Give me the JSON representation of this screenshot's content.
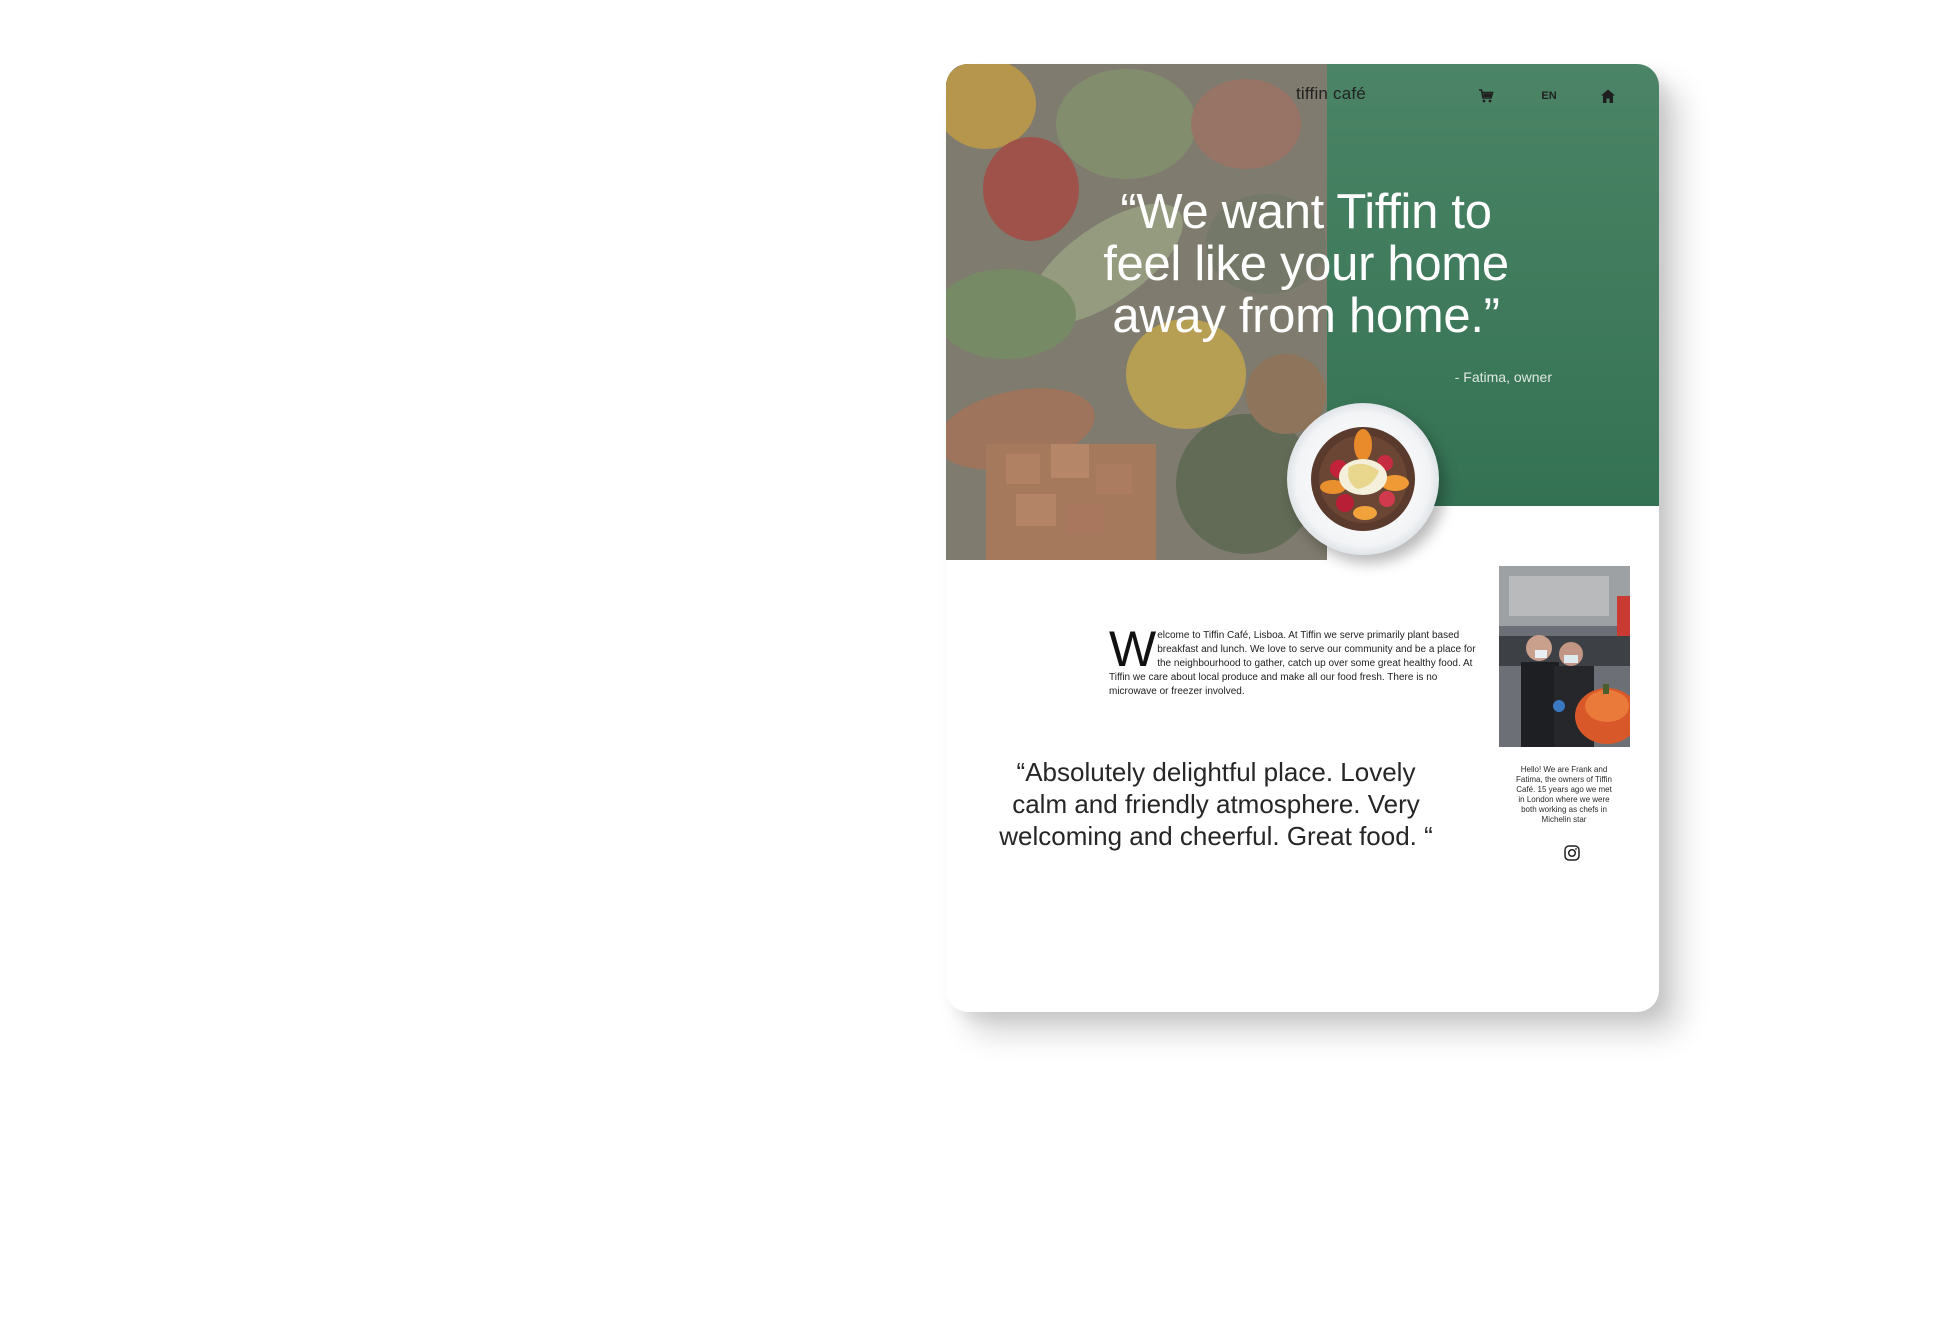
{
  "brand": {
    "name": "tiffin café"
  },
  "nav": {
    "cart_icon": "cart-icon",
    "language": "EN",
    "home_icon": "home-icon"
  },
  "hero": {
    "quote": "“We want Tiffin to feel like your home away from home.”",
    "author": "- Fatima, owner"
  },
  "welcome": {
    "dropcap": "W",
    "text": "elcome to Tiffin Café, Lisboa. At Tiffin we serve primarily plant based breakfast and lunch. We love to serve our community and be a place for the neighbourhood to gather, catch up over some great healthy food. At Tiffin we care about local produce and make all our food fresh. There is no microwave or freezer involved."
  },
  "owners": {
    "caption": "Hello! We are Frank and Fatima, the owners of Tiffin Café. 15 years ago we met in London where we were both working as chefs in Michelin star"
  },
  "review": {
    "text": "“Absolutely delightful place. Lovely calm and friendly atmosphere. Very welcoming and cheerful. Great food. “"
  },
  "social": {
    "instagram_icon": "instagram-icon"
  },
  "colors": {
    "green_panel": "#3e7a5b",
    "text_dark": "#222222",
    "background": "#ffffff"
  }
}
